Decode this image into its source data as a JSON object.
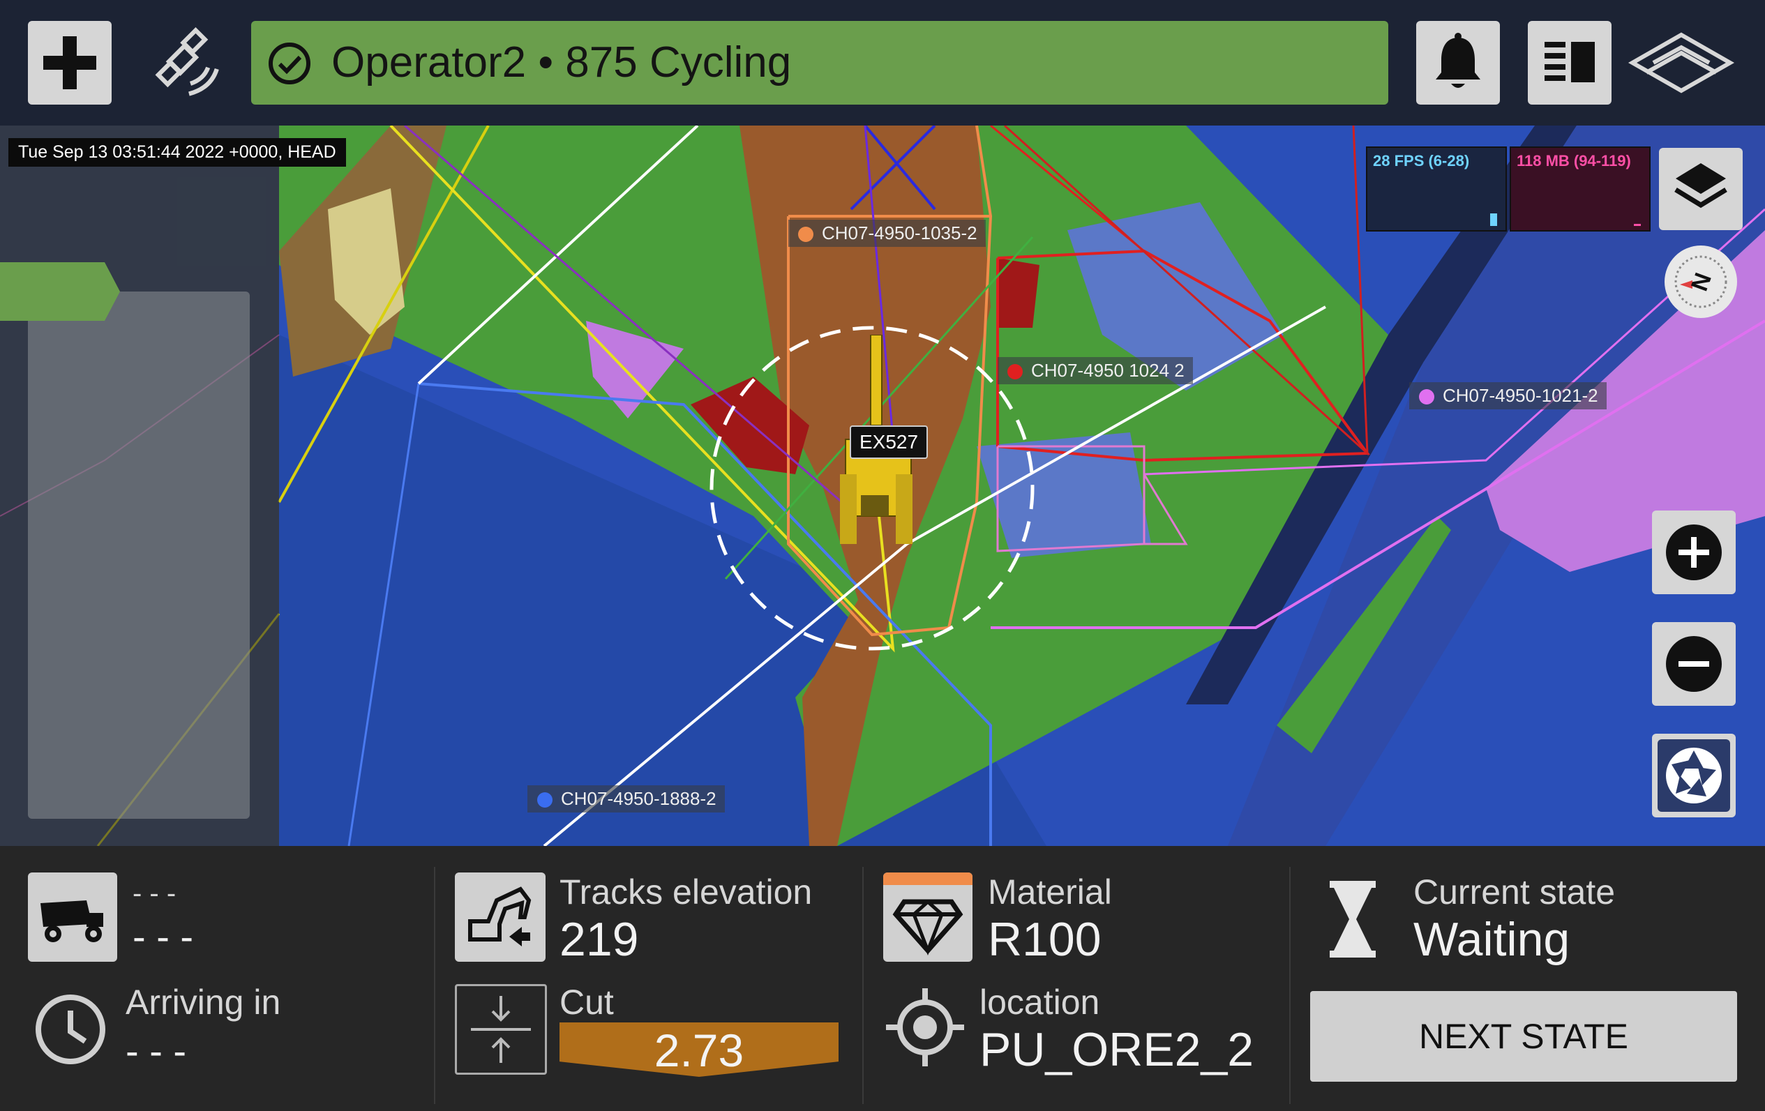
{
  "header": {
    "status_text": "Operator2 • 875 Cycling",
    "status_color": "#6a9e4c",
    "icons": [
      "plus-icon",
      "satellite-icon",
      "check-circle-icon",
      "bell-icon",
      "panel-icon",
      "brand-logo-icon"
    ]
  },
  "map": {
    "timestamp": "Tue Sep 13 03:51:44 2022 +0000, HEAD",
    "labels": {
      "l1035": {
        "text": "CH07-4950-1035-2",
        "color": "#f08c4a"
      },
      "l1024": {
        "text": "CH07-4950 1024 2",
        "color": "#e02020"
      },
      "l1021": {
        "text": "CH07-4950-1021-2",
        "color": "#e070f0"
      },
      "l1888": {
        "text": "CH07-4950-1888-2",
        "color": "#3a6df0"
      }
    },
    "machine_label": "EX527",
    "perf": {
      "fps": "28 FPS (6-28)",
      "mem": "118 MB (94-119)"
    }
  },
  "bottom": {
    "truck": {
      "line1": "- - -",
      "line2": "- - -"
    },
    "arriving": {
      "label": "Arriving in",
      "value": "- - -"
    },
    "tracks": {
      "label": "Tracks elevation",
      "value": "219"
    },
    "cut": {
      "label": "Cut",
      "value": "2.73",
      "color": "#b06e1a"
    },
    "material": {
      "label": "Material",
      "value": "R100",
      "accent": "#f08c4a"
    },
    "location": {
      "label": "location",
      "value": "PU_ORE2_2"
    },
    "state": {
      "label": "Current state",
      "value": "Waiting"
    },
    "next_button": "NEXT STATE"
  }
}
